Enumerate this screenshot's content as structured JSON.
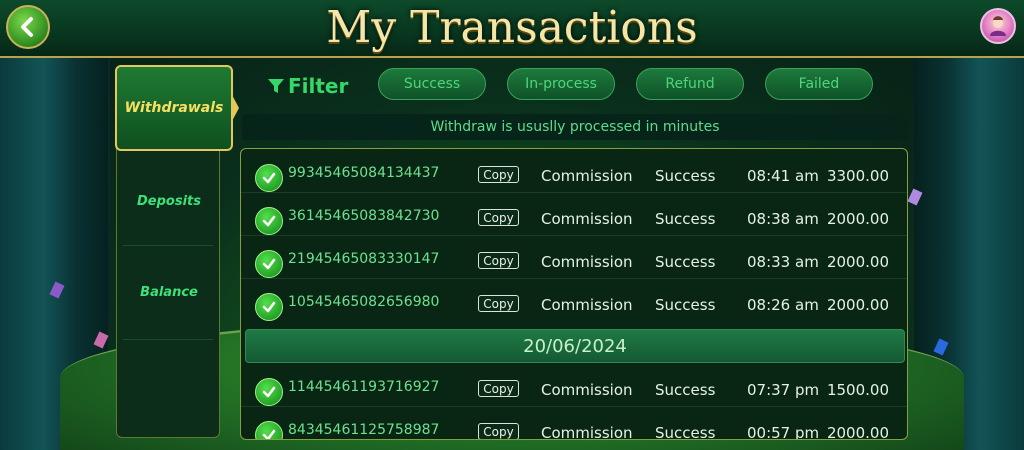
{
  "header": {
    "title": "My Transactions"
  },
  "sidebar": {
    "tabs": [
      {
        "label": "Withdrawals"
      },
      {
        "label": "Deposits"
      },
      {
        "label": "Balance"
      }
    ]
  },
  "filter": {
    "label": "Filter",
    "options": [
      "Success",
      "In-process",
      "Refund",
      "Failed"
    ]
  },
  "notice": "Withdraw is ususlly processed in minutes",
  "copy_label": "Copy",
  "transactions": [
    {
      "id": "99345465084134437",
      "type": "Commission",
      "status": "Success",
      "time": "08:41 am",
      "amount": "3300.00"
    },
    {
      "id": "36145465083842730",
      "type": "Commission",
      "status": "Success",
      "time": "08:38 am",
      "amount": "2000.00"
    },
    {
      "id": "21945465083330147",
      "type": "Commission",
      "status": "Success",
      "time": "08:33 am",
      "amount": "2000.00"
    },
    {
      "id": "10545465082656980",
      "type": "Commission",
      "status": "Success",
      "time": "08:26 am",
      "amount": "2000.00"
    }
  ],
  "date_separator": "20/06/2024",
  "transactions_2": [
    {
      "id": "11445461193716927",
      "type": "Commission",
      "status": "Success",
      "time": "07:37 pm",
      "amount": "1500.00"
    },
    {
      "id": "84345461125758987",
      "type": "Commission",
      "status": "Success",
      "time": "00:57 pm",
      "amount": "2000.00"
    }
  ],
  "colors": {
    "accent_gold": "#f3e6a8",
    "success_green": "#36d86a",
    "panel_bg": "#092615"
  }
}
